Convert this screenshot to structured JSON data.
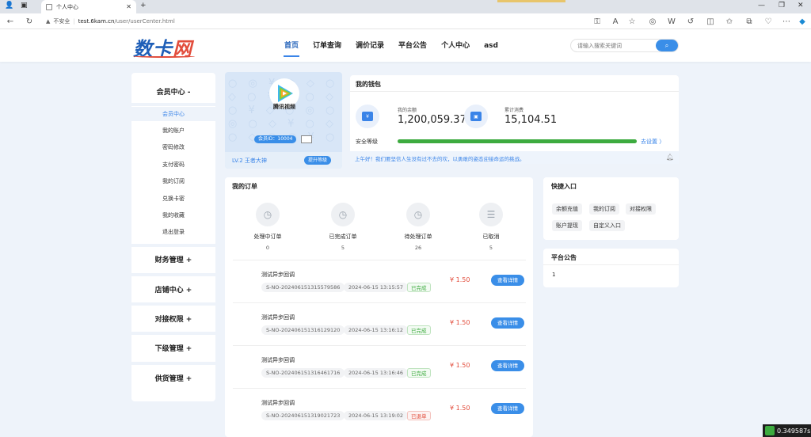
{
  "browser": {
    "tab_title": "个人中心",
    "insecure_label": "不安全",
    "url_host": "test.6kam.cn",
    "url_path": "/user/userCenter.html"
  },
  "site": {
    "logo_a": "数卡",
    "logo_b": "网",
    "nav": [
      "首页",
      "订单查询",
      "调价记录",
      "平台公告",
      "个人中心",
      "asd"
    ],
    "search_placeholder": "请输入搜索关键词"
  },
  "sidebar": {
    "member_title": "会员中心 -",
    "items": [
      "会员中心",
      "我的账户",
      "密码修改",
      "支付密码",
      "我的订阅",
      "兑换卡密",
      "我的收藏",
      "退出登录"
    ],
    "groups": [
      "财务管理 +",
      "店铺中心 +",
      "对接权限 +",
      "下级管理 +",
      "供货管理 +"
    ]
  },
  "profile": {
    "avatar_text": "腾讯视频",
    "member_id": "会员ID：10004",
    "level": "LV.2 王者大神",
    "upgrade_btn": "提升等级"
  },
  "wallet": {
    "title": "我的钱包",
    "balance_label": "我的余额",
    "balance_value": "1,200,059.37",
    "spend_label": "累计消费",
    "spend_value": "15,104.51",
    "security_label": "安全等级",
    "security_level": 1.0,
    "security_link": "去设置 〉",
    "notice": "上午好！我们要坚信人生没有过不去的坎，以勇敢的姿态迎接命运的挑战。"
  },
  "orders": {
    "title": "我的订单",
    "stats": [
      {
        "label": "处理中订单",
        "count": "0"
      },
      {
        "label": "已完成订单",
        "count": "5"
      },
      {
        "label": "待处理订单",
        "count": "26"
      },
      {
        "label": "已取消",
        "count": "5"
      }
    ],
    "rows": [
      {
        "title": "测试异步回调",
        "order_no": "S-NO-2024061513155795​86",
        "time": "2024-06-15 13:15:57",
        "status": "已完成",
        "price": "¥ 1.50",
        "btn": "查看详情"
      },
      {
        "title": "测试异步回调",
        "order_no": "S-NO-202406151316129120",
        "time": "2024-06-15 13:16:12",
        "status": "已完成",
        "price": "¥ 1.50",
        "btn": "查看详情"
      },
      {
        "title": "测试异步回调",
        "order_no": "S-NO-202406151316461716",
        "time": "2024-06-15 13:16:46",
        "status": "已完成",
        "price": "¥ 1.50",
        "btn": "查看详情"
      },
      {
        "title": "测试异步回调",
        "order_no": "S-NO-202406151319021723",
        "time": "2024-06-15 13:19:02",
        "status": "已退单",
        "price": "¥ 1.50",
        "btn": "查看详情"
      }
    ]
  },
  "quick": {
    "title": "快捷入口",
    "items": [
      "余额充值",
      "我的订阅",
      "对接权限",
      "账户提现",
      "自定义入口"
    ]
  },
  "announce": {
    "title": "平台公告",
    "text": "1"
  },
  "timer": "0.349587s"
}
